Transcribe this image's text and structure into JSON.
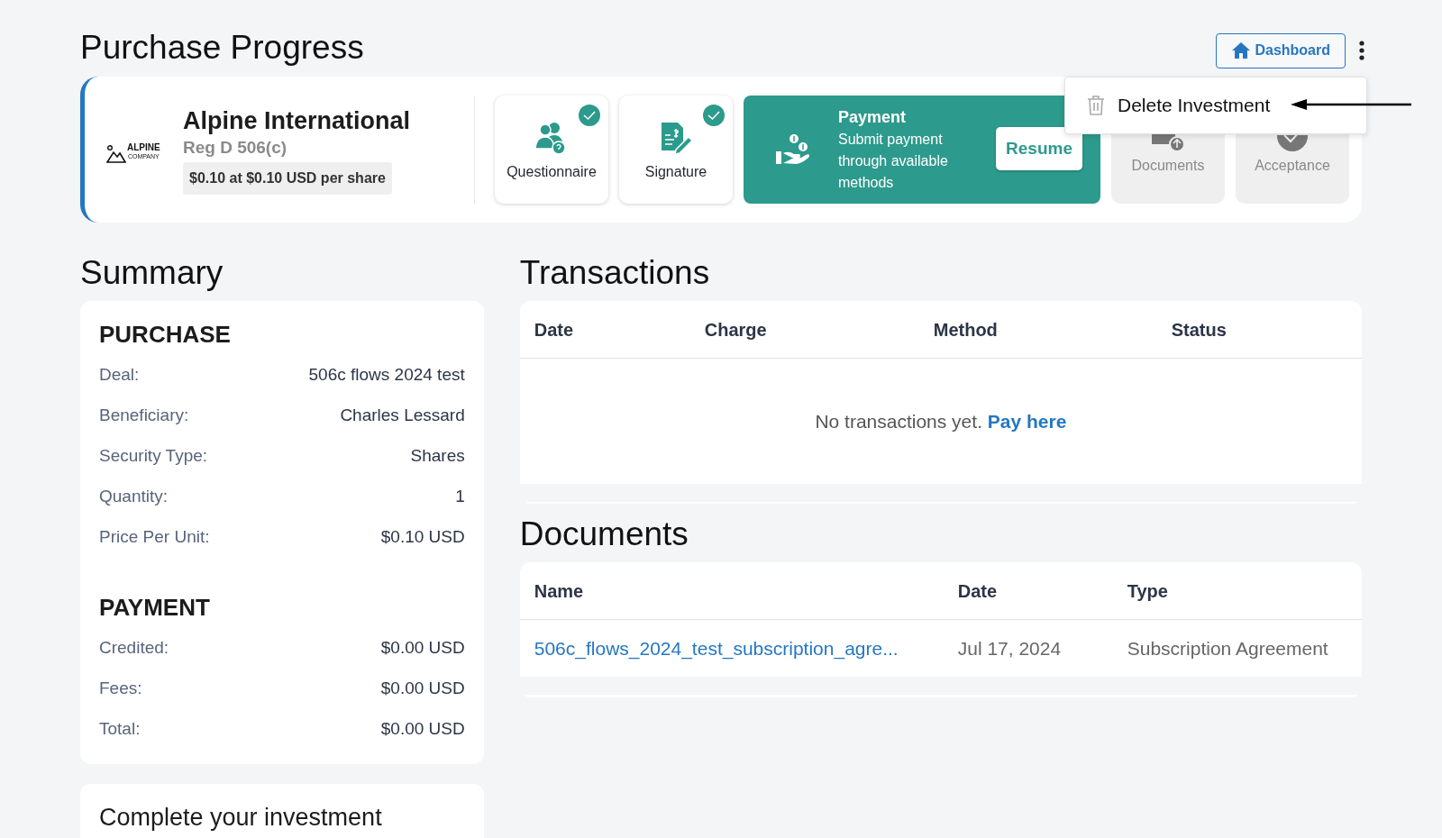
{
  "page_title": "Purchase Progress",
  "header": {
    "dashboard_button": "Dashboard",
    "menu_open": true
  },
  "menu": {
    "items": [
      {
        "label": "Delete Investment"
      }
    ]
  },
  "offering": {
    "logo_name": "ALPINE",
    "logo_sub": "COMPANY",
    "name": "Alpine International",
    "regulation": "Reg D 506(c)",
    "price_badge": "$0.10 at $0.10 USD per share"
  },
  "steps": [
    {
      "kind": "done",
      "label": "Questionnaire"
    },
    {
      "kind": "done",
      "label": "Signature"
    },
    {
      "kind": "current",
      "label": "Payment",
      "description": "Submit payment through available methods",
      "action": "Resume"
    },
    {
      "kind": "pending",
      "label": "Documents"
    },
    {
      "kind": "pending",
      "label": "Acceptance"
    }
  ],
  "summary": {
    "title": "Summary",
    "sections": [
      {
        "heading": "PURCHASE",
        "rows": [
          {
            "label": "Deal:",
            "value": "506c flows 2024 test"
          },
          {
            "label": "Beneficiary:",
            "value": "Charles Lessard"
          },
          {
            "label": "Security Type:",
            "value": "Shares"
          },
          {
            "label": "Quantity:",
            "value": "1"
          },
          {
            "label": "Price Per Unit:",
            "value": "$0.10 USD"
          }
        ]
      },
      {
        "heading": "PAYMENT",
        "rows": [
          {
            "label": "Credited:",
            "value": "$0.00 USD"
          },
          {
            "label": "Fees:",
            "value": "$0.00 USD"
          },
          {
            "label": "Total:",
            "value": "$0.00 USD"
          }
        ]
      }
    ]
  },
  "complete_card": {
    "title": "Complete your investment"
  },
  "transactions": {
    "title": "Transactions",
    "columns": [
      "Date",
      "Charge",
      "Method",
      "Status"
    ],
    "empty_text": "No transactions yet.",
    "empty_link": "Pay here"
  },
  "documents": {
    "title": "Documents",
    "columns": [
      "Name",
      "Date",
      "Type"
    ],
    "rows": [
      {
        "name": "506c_flows_2024_test_subscription_agre...",
        "date": "Jul 17, 2024",
        "type": "Subscription Agreement"
      }
    ]
  }
}
